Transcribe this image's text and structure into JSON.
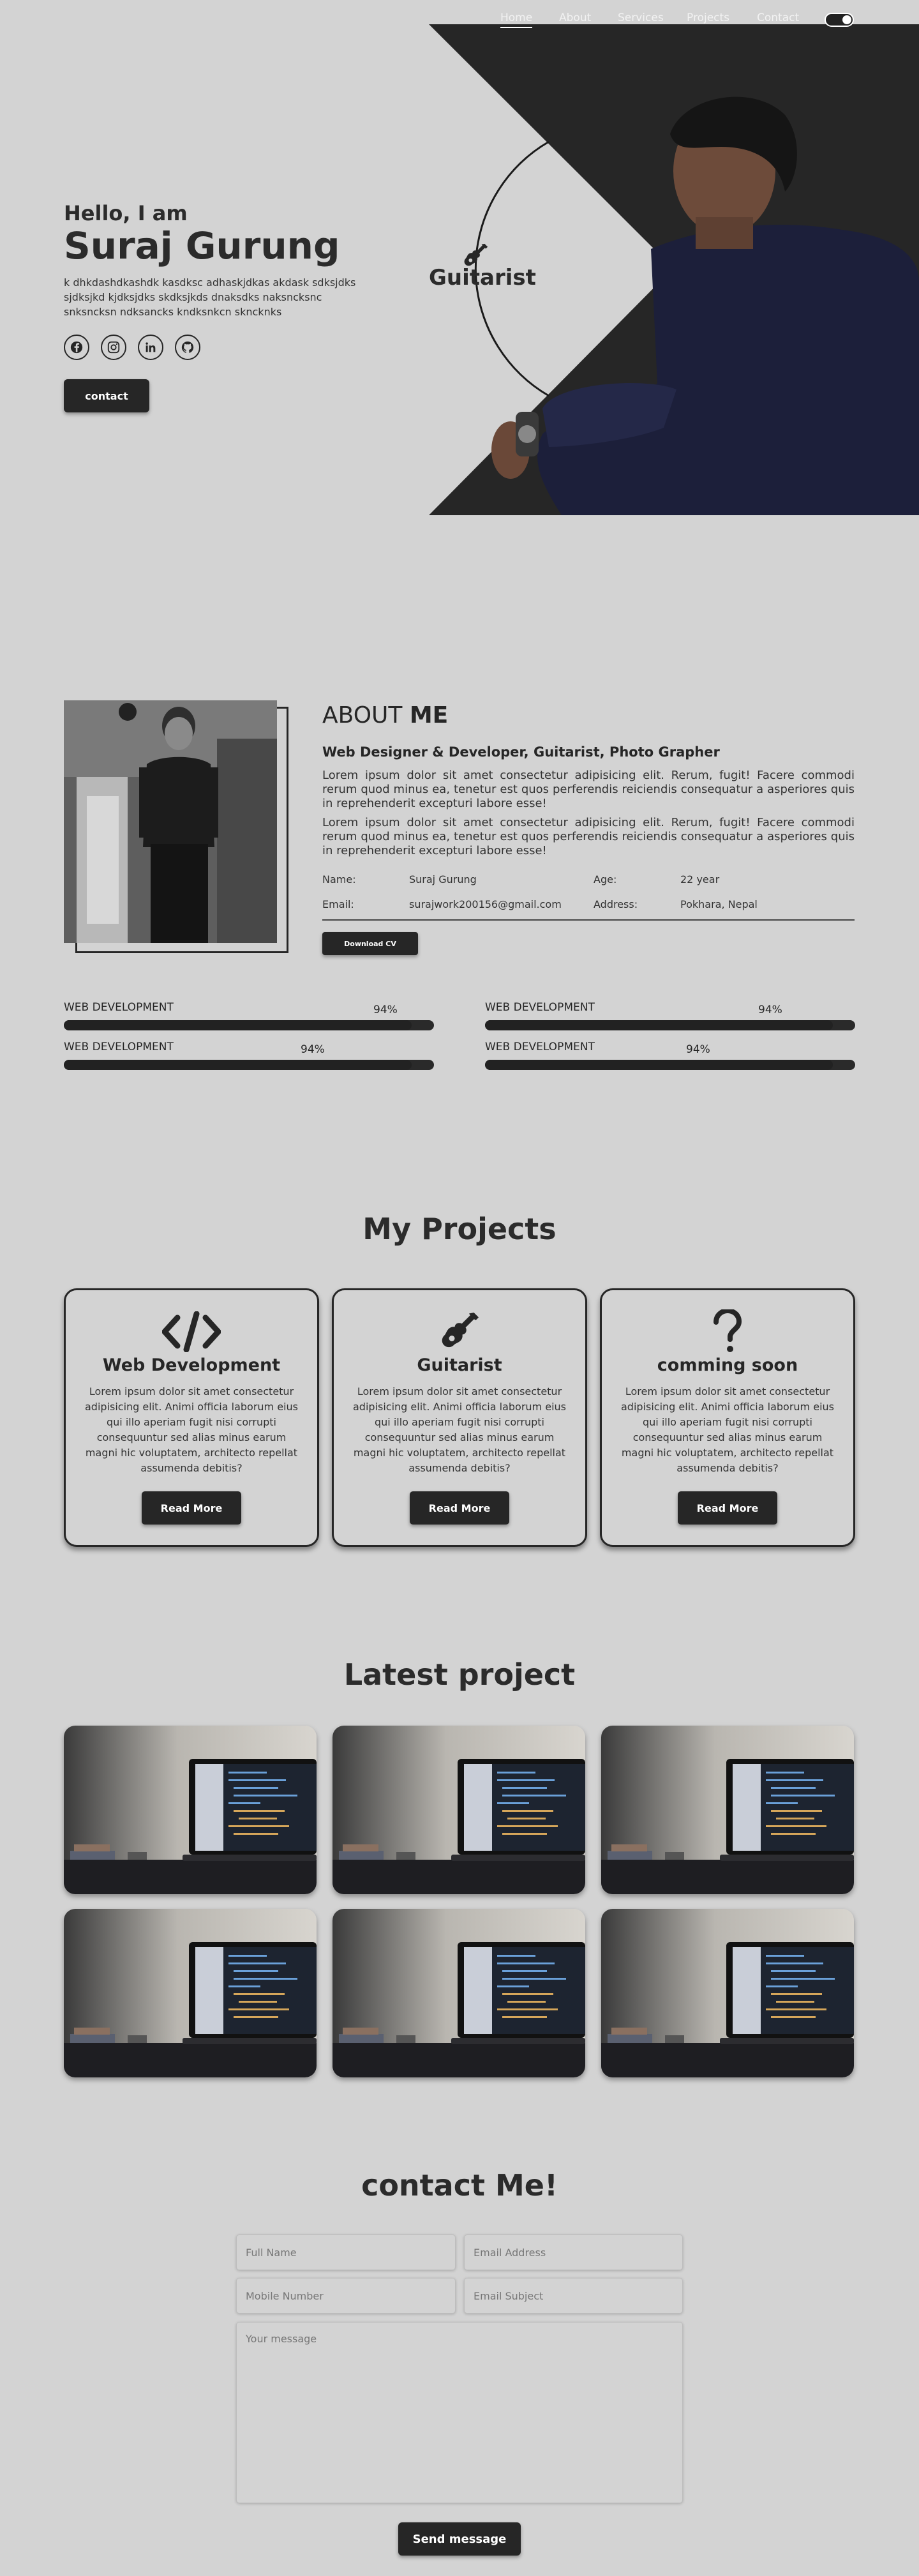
{
  "nav": {
    "items": [
      {
        "label": "Home"
      },
      {
        "label": "About"
      },
      {
        "label": "Services"
      },
      {
        "label": "Projects"
      },
      {
        "label": "Contact"
      }
    ]
  },
  "hero": {
    "greeting": "Hello, I am",
    "name": "Suraj Gurung",
    "description": "k dhkdashdkashdk kasdksc adhaskjdkas akdask sdksjdks sjdksjkd kjdksjdks skdksjkds dnaksdks naksncksnc snksncksn ndksancks kndksnkcn skncknks",
    "socials": [
      {
        "icon": "facebook-icon"
      },
      {
        "icon": "instagram-icon"
      },
      {
        "icon": "linkedin-icon"
      },
      {
        "icon": "github-icon"
      }
    ],
    "contact_label": "contact",
    "role_label": "Guitarist"
  },
  "about": {
    "title_light": "ABOUT",
    "title_bold": "ME",
    "subtitle": "Web Designer & Developer, Guitarist, Photo Grapher",
    "paragraphs": [
      "Lorem ipsum dolor sit amet consectetur adipisicing elit. Rerum, fugit! Facere commodi rerum quod minus ea, tenetur est quos perferendis reiciendis consequatur a asperiores quis in reprehenderit excepturi labore esse!",
      "Lorem ipsum dolor sit amet consectetur adipisicing elit. Rerum, fugit! Facere commodi rerum quod minus ea, tenetur est quos perferendis reiciendis consequatur a asperiores quis in reprehenderit excepturi labore esse!"
    ],
    "info": {
      "name_label": "Name:",
      "name_value": "Suraj Gurung",
      "age_label": "Age:",
      "age_value": "22 year",
      "email_label": "Email:",
      "email_value": "surajwork200156@gmail.com",
      "address_label": "Address:",
      "address_value": "Pokhara, Nepal"
    },
    "cv_label": "Download CV"
  },
  "skills": [
    {
      "name": "WEB DEVELOPMENT",
      "percent": "94%",
      "value": 94
    },
    {
      "name": "WEB DEVELOPMENT",
      "percent": "94%",
      "value": 94
    },
    {
      "name": "WEB DEVELOPMENT",
      "percent": "94%",
      "value": 94
    },
    {
      "name": "WEB DEVELOPMENT",
      "percent": "94%",
      "value": 94
    }
  ],
  "projects": {
    "title": "My Projects",
    "cards": [
      {
        "icon": "code-icon",
        "title": "Web Development",
        "text": "Lorem ipsum dolor sit amet consectetur adipisicing elit. Animi officia laborum eius qui illo aperiam fugit nisi corrupti consequuntur sed alias minus earum magni hic voluptatem, architecto repellat assumenda debitis?",
        "button": "Read More"
      },
      {
        "icon": "guitar-icon",
        "title": "Guitarist",
        "text": "Lorem ipsum dolor sit amet consectetur adipisicing elit. Animi officia laborum eius qui illo aperiam fugit nisi corrupti consequuntur sed alias minus earum magni hic voluptatem, architecto repellat assumenda debitis?",
        "button": "Read More"
      },
      {
        "icon": "question-icon",
        "title": "comming soon",
        "text": "Lorem ipsum dolor sit amet consectetur adipisicing elit. Animi officia laborum eius qui illo aperiam fugit nisi corrupti consequuntur sed alias minus earum magni hic voluptatem, architecto repellat assumenda debitis?",
        "button": "Read More"
      }
    ]
  },
  "latest": {
    "title": "Latest project"
  },
  "contact": {
    "title": "contact Me!",
    "full_name_placeholder": "Full Name",
    "email_placeholder": "Email Address",
    "mobile_placeholder": "Mobile Number",
    "subject_placeholder": "Email Subject",
    "message_placeholder": "Your message",
    "send_label": "Send message"
  },
  "colors": {
    "background": "#d3d3d3",
    "dark": "#262626"
  }
}
